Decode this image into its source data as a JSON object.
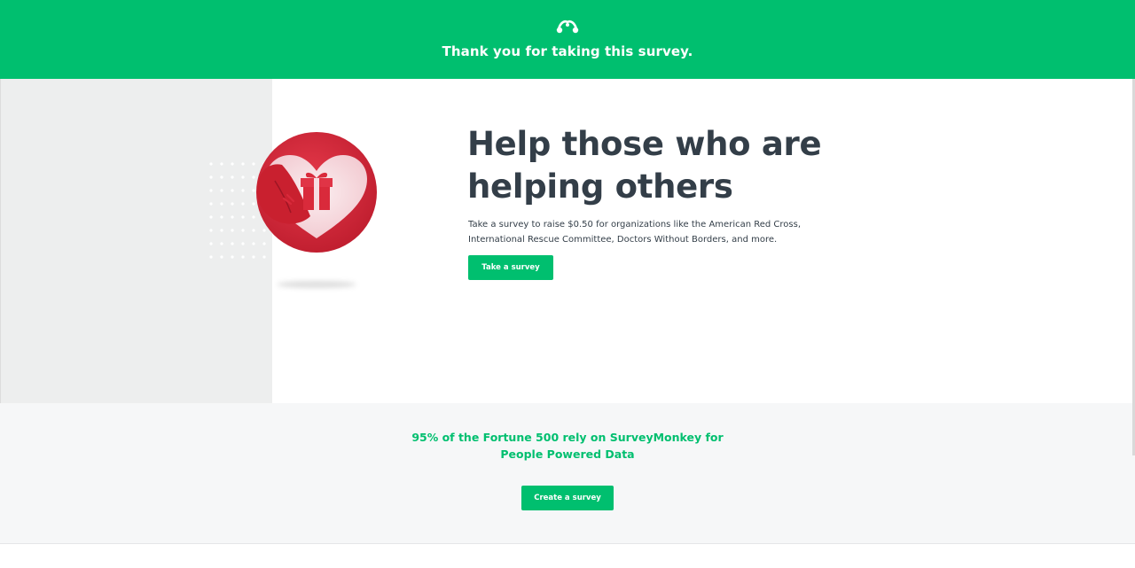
{
  "header": {
    "logo_icon": "surveymonkey-logo-icon",
    "message": "Thank you for taking this survey.",
    "background": "#00bf6f"
  },
  "hero": {
    "illustration_icon": "heart-gift-icon",
    "headline": "Help those who are helping others",
    "description": "Take a survey to raise $0.50 for organizations like the American Red Cross, International Rescue Committee, Doctors Without Borders, and more.",
    "cta_label": "Take a survey"
  },
  "fortune": {
    "message": "95% of the Fortune 500 rely on SurveyMonkey for People Powered Data",
    "cta_label": "Create a survey"
  },
  "colors": {
    "brand_green": "#00bf6f",
    "heart_red": "#d52b3a",
    "text_dark": "#333e48"
  }
}
